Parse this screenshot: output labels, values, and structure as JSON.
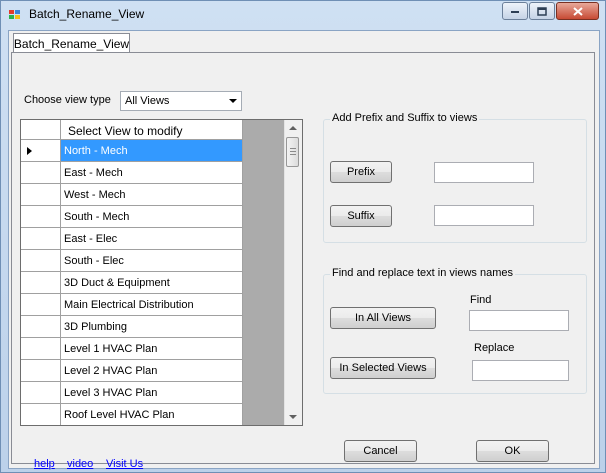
{
  "window": {
    "title": "Batch_Rename_View"
  },
  "tab": {
    "label": "Batch_Rename_View"
  },
  "view_type": {
    "label": "Choose view type",
    "selected": "All Views"
  },
  "grid": {
    "column_header": "Select View to modify",
    "selected_index": 0,
    "rows": [
      "North - Mech",
      "East - Mech",
      "West - Mech",
      "South - Mech",
      "East - Elec",
      "South - Elec",
      "3D Duct & Equipment",
      "Main Electrical Distribution",
      "3D Plumbing",
      "Level 1 HVAC Plan",
      "Level 2 HVAC Plan",
      "Level 3 HVAC Plan",
      "Roof Level HVAC Plan"
    ]
  },
  "prefix_suffix": {
    "title": "Add Prefix and Suffix to views",
    "prefix_button": "Prefix",
    "suffix_button": "Suffix",
    "prefix_value": "",
    "suffix_value": ""
  },
  "find_replace": {
    "title": "Find and replace text in views names",
    "all_views_button": "In All Views",
    "selected_views_button": "In Selected Views",
    "find_label": "Find",
    "replace_label": "Replace",
    "find_value": "",
    "replace_value": ""
  },
  "actions": {
    "cancel": "Cancel",
    "ok": "OK"
  },
  "links": {
    "help": "help",
    "video": "video",
    "visit_us": "Visit Us"
  },
  "colors": {
    "selection": "#3399ff",
    "link": "#0000ff",
    "form_bg": "#f0f0f0",
    "frame": "#bcd1ea"
  }
}
